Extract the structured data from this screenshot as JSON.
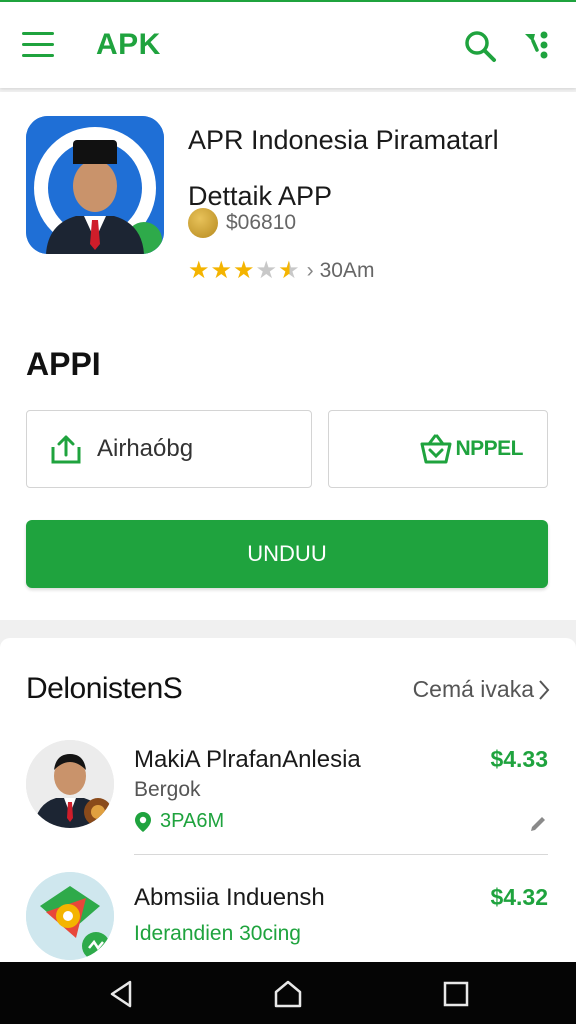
{
  "header": {
    "brand": "APK",
    "menu_icon": "hamburger-menu-icon",
    "search_icon": "search-icon",
    "filter_icon": "filter-icon",
    "accent_color": "#1fa33e"
  },
  "app": {
    "title": "APR Indonesia Piramatarl Dettaik APP",
    "meta": "$06810",
    "rating_stars": 3.5,
    "rating_text": "30Am"
  },
  "section": {
    "title": "APPI",
    "option_left_label": "Airhaóbg",
    "option_right_label": "NPPEL",
    "download_label": "UNDUU"
  },
  "list": {
    "heading": "DelonistenS",
    "see_all": "Cemá ivaka",
    "items": [
      {
        "title": "MakiA PlrafanAnlesia",
        "subtitle": "Bergok",
        "size": "3PA6M",
        "price": "$4.33"
      },
      {
        "title": "Abmsiia Induensh",
        "subtitle": "Iderandien 30cing",
        "price": "$4.32"
      }
    ]
  },
  "navbar": {
    "back_icon": "back-triangle-icon",
    "home_icon": "home-icon",
    "recents_icon": "recents-square-icon"
  }
}
